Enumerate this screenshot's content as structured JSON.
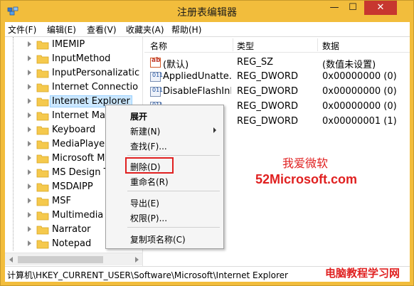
{
  "window": {
    "title": "注册表编辑器"
  },
  "titlebar_buttons": {
    "minimize": "—",
    "maximize": "☐",
    "close": "✕"
  },
  "menu": [
    "文件(F)",
    "编辑(E)",
    "查看(V)",
    "收藏夹(A)",
    "帮助(H)"
  ],
  "tree": {
    "items": [
      "IMEMIP",
      "InputMethod",
      "InputPersonalizatic",
      "Internet Connectio",
      "Internet Explorer",
      "Internet Mail",
      "Keyboard",
      "MediaPlayer",
      "Microsoft Ma",
      "MS Design To",
      "MSDAIPP",
      "MSF",
      "Multimedia",
      "Narrator",
      "Notepad"
    ],
    "selected_index": 4
  },
  "list": {
    "columns": [
      "名称",
      "类型",
      "数据"
    ],
    "rows": [
      {
        "icon": "string-value-icon",
        "name": "(默认)",
        "type": "REG_SZ",
        "data": "(数值未设置)"
      },
      {
        "icon": "dword-value-icon",
        "name": "AppliedUnatte...",
        "type": "REG_DWORD",
        "data": "0x00000000 (0)"
      },
      {
        "icon": "dword-value-icon",
        "name": "DisableFlashInIE",
        "type": "REG_DWORD",
        "data": "0x00000000 (0)"
      },
      {
        "icon": "dword-value-icon",
        "name": "",
        "type": "REG_DWORD",
        "data": "0x00000000 (0)"
      },
      {
        "icon": "dword-value-icon",
        "name": "",
        "type": "REG_DWORD",
        "data": "0x00000001 (1)"
      }
    ]
  },
  "context_menu": {
    "items": [
      "展开",
      "新建(N)",
      "查找(F)...",
      "删除(D)",
      "重命名(R)",
      "导出(E)",
      "权限(P)...",
      "复制项名称(C)"
    ],
    "highlighted": "删除(D)"
  },
  "statusbar": {
    "path": "计算机\\HKEY_CURRENT_USER\\Software\\Microsoft\\Internet Explorer"
  },
  "watermarks": {
    "cn": "我爱微软",
    "site": "52Microsoft.com",
    "bottom": "电脑教程学习网"
  },
  "colors": {
    "titlebar": "#f2bd3c",
    "selection": "#cce8ff",
    "highlight_box": "#e02020"
  }
}
